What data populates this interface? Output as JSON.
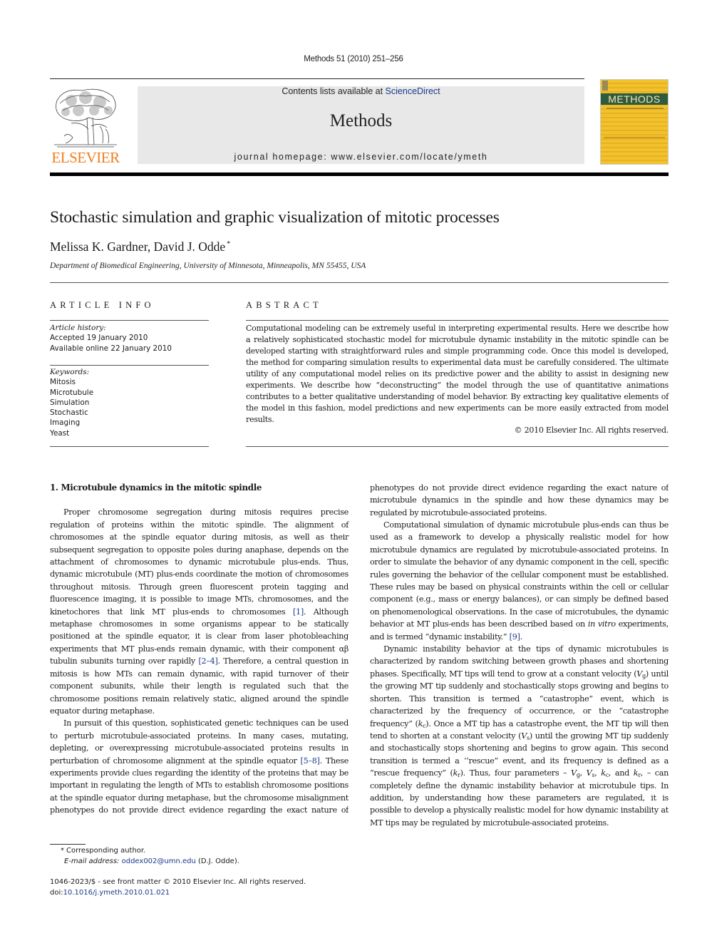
{
  "header": {
    "running_head": "Methods 51 (2010) 251–256",
    "contents_prefix": "Contents lists available at ",
    "contents_link": "ScienceDirect",
    "journal_name": "Methods",
    "homepage": "journal homepage: www.elsevier.com/locate/ymeth",
    "publisher_logo_text": "ELSEVIER",
    "cover_title": "METHODS",
    "colors": {
      "elsevier_orange": "#f07e1b",
      "banner_gray": "#e8e8e8",
      "link_blue": "#1b3a8c",
      "cover_yellow": "#f2c12e",
      "cover_band_green": "#2f5a3e"
    }
  },
  "article": {
    "title": "Stochastic simulation and graphic visualization of mitotic processes",
    "authors": "Melissa K. Gardner, David J. Odde",
    "author_mark": "*",
    "affiliation": "Department of Biomedical Engineering, University of Minnesota, Minneapolis, MN 55455, USA"
  },
  "article_info": {
    "heading": "ARTICLE INFO",
    "history_label": "Article history:",
    "history": [
      "Accepted 19 January 2010",
      "Available online 22 January 2010"
    ],
    "keywords_label": "Keywords:",
    "keywords": [
      "Mitosis",
      "Microtubule",
      "Simulation",
      "Stochastic",
      "Imaging",
      "Yeast"
    ]
  },
  "abstract": {
    "heading": "ABSTRACT",
    "text": "Computational modeling can be extremely useful in interpreting experimental results. Here we describe how a relatively sophisticated stochastic model for microtubule dynamic instability in the mitotic spindle can be developed starting with straightforward rules and simple programming code. Once this model is developed, the method for comparing simulation results to experimental data must be carefully considered. The ultimate utility of any computational model relies on its predictive power and the ability to assist in designing new experiments. We describe how “deconstructing” the model through the use of quantitative animations contributes to a better qualitative understanding of model behavior. By extracting key qualitative elements of the model in this fashion, model predictions and new experiments can be more easily extracted from model results.",
    "copyright": "© 2010 Elsevier Inc. All rights reserved."
  },
  "body": {
    "section_heading": "1. Microtubule dynamics in the mitotic spindle",
    "p1": {
      "a": "Proper chromosome segregation during mitosis requires precise regulation of proteins within the mitotic spindle. The alignment of chromosomes at the spindle equator during mitosis, as well as their subsequent segregation to opposite poles during anaphase, depends on the attachment of chromosomes to dynamic microtubule plus-ends. Thus, dynamic microtubule (MT) plus-ends coordinate the motion of chromosomes throughout mitosis. Through green fluorescent protein tagging and fluorescence imaging, it is possible to image MTs, chromosomes, and the kinetochores that link MT plus-ends to chromosomes ",
      "ref1": "[1]",
      "b": ". Although metaphase chromosomes in some organisms appear to be statically positioned at the spindle equator, it is clear from laser photobleaching experiments that MT plus-ends remain dynamic, with their component αβ tubulin subunits turning over rapidly ",
      "ref2": "[2–4]",
      "c": ". Therefore, a central question in mitosis is how MTs can remain dynamic, with rapid turnover of their component subunits, while their length is regulated such that the chromosome positions remain relatively static, aligned around the spindle equator during metaphase."
    },
    "p2": {
      "a": "In pursuit of this question, sophisticated genetic techniques can be used to perturb microtubule-associated proteins. In many cases, mutating, depleting, or overexpressing microtubule-associated proteins results in perturbation of chromosome alignment at the spindle equator ",
      "ref": "[5–8]",
      "b": ". These experiments provide clues regarding the identity of the proteins that may be important in regulating the length of MTs to establish chromosome positions at the spindle equator during metaphase, but the chromosome misalignment phenotypes do not provide direct evidence regarding the exact nature of microtubule dynamics in the spindle and how these dynamics may be regulated by microtubule-associated proteins."
    },
    "p3": {
      "a": "Computational simulation of dynamic microtubule plus-ends can thus be used as a framework to develop a physically realistic model for how microtubule dynamics are regulated by microtubule-associated proteins. In order to simulate the behavior of any dynamic component in the cell, specific rules governing the behavior of the cellular component must be established. These rules may be based on physical constraints within the cell or cellular component (e.g., mass or energy balances), or can simply be defined based on phenomenological observations. In the case of microtubules, the dynamic behavior at MT plus-ends has been described based on ",
      "italic": "in vitro",
      "b": " experiments, and is termed “dynamic instability.” ",
      "ref": "[9]",
      "c": "."
    },
    "p4": {
      "s1": "Dynamic instability behavior at the tips of dynamic microtubules is characterized by random switching between growth phases and shortening phases. Specifically, MT tips will tend to grow at a constant velocity (",
      "vg": "V",
      "vg_sub": "g",
      "s2": ") until the growing MT tip suddenly and stochastically stops growing and begins to shorten. This transition is termed a “catastrophe” event, which is characterized by the frequency of occurrence, or the “catastrophe frequency” (",
      "kc": "k",
      "kc_sub": "c",
      "s3": "). Once a MT tip has a catastrophe event, the MT tip will then tend to shorten at a constant velocity (",
      "vs": "V",
      "vs_sub": "s",
      "s4": ") until the growing MT tip suddenly and stochastically stops shortening and begins to grow again. This second transition is termed a ‘‘rescue” event, and its frequency is defined as a “rescue frequency” (",
      "kr": "k",
      "kr_sub": "r",
      "s5": "). Thus, four parameters – ",
      "s6": ", ",
      "s7": ", and ",
      "s8": ", – can completely define the dynamic instability behavior at microtubule tips. In addition, by understanding how these parameters are regulated, it is possible to develop a physically realistic model for how dynamic instability at MT tips may be regulated by microtubule-associated proteins."
    }
  },
  "footnotes": {
    "star": "*",
    "corresponding": "Corresponding author.",
    "email_label": "E-mail address:",
    "email": "oddex002@umn.edu",
    "email_suffix": " (D.J. Odde).",
    "issn": "1046-2023/$ - see front matter © 2010 Elsevier Inc. All rights reserved.",
    "doi_label": "doi:",
    "doi": "10.1016/j.ymeth.2010.01.021"
  }
}
